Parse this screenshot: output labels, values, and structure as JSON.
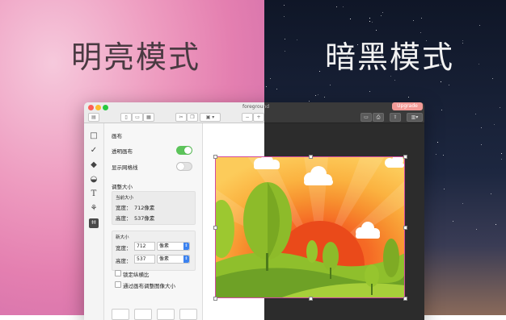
{
  "hero": {
    "light_title": "明亮模式",
    "dark_title": "暗黑模式"
  },
  "window": {
    "doc_title": "foregrou",
    "doc_title_dark": "nd",
    "upgrade_label": "Upgrade"
  },
  "panel": {
    "canvas_header": "画布",
    "transparent_canvas": "透明画布",
    "show_grid": "显示网格线",
    "resize_header": "调整大小",
    "current_size": "当前大小",
    "width_label": "宽度：",
    "height_label": "高度：",
    "current_width": "712像素",
    "current_height": "537像素",
    "new_size": "新大小",
    "new_width_label": "宽度：",
    "new_height_label": "高度：",
    "new_width_value": "712",
    "new_height_value": "537",
    "unit_width": "像素",
    "unit_height": "像素",
    "lock_ratio": "锁定纵横比",
    "resize_image": "通过画布调整图像大小",
    "transparent_on": true,
    "grid_on": false
  },
  "colors": {
    "accent_green": "#5cc45a",
    "accent_blue": "#3b82f0",
    "upgrade_pink": "#f29a97",
    "selection_magenta": "#d24aa0"
  }
}
